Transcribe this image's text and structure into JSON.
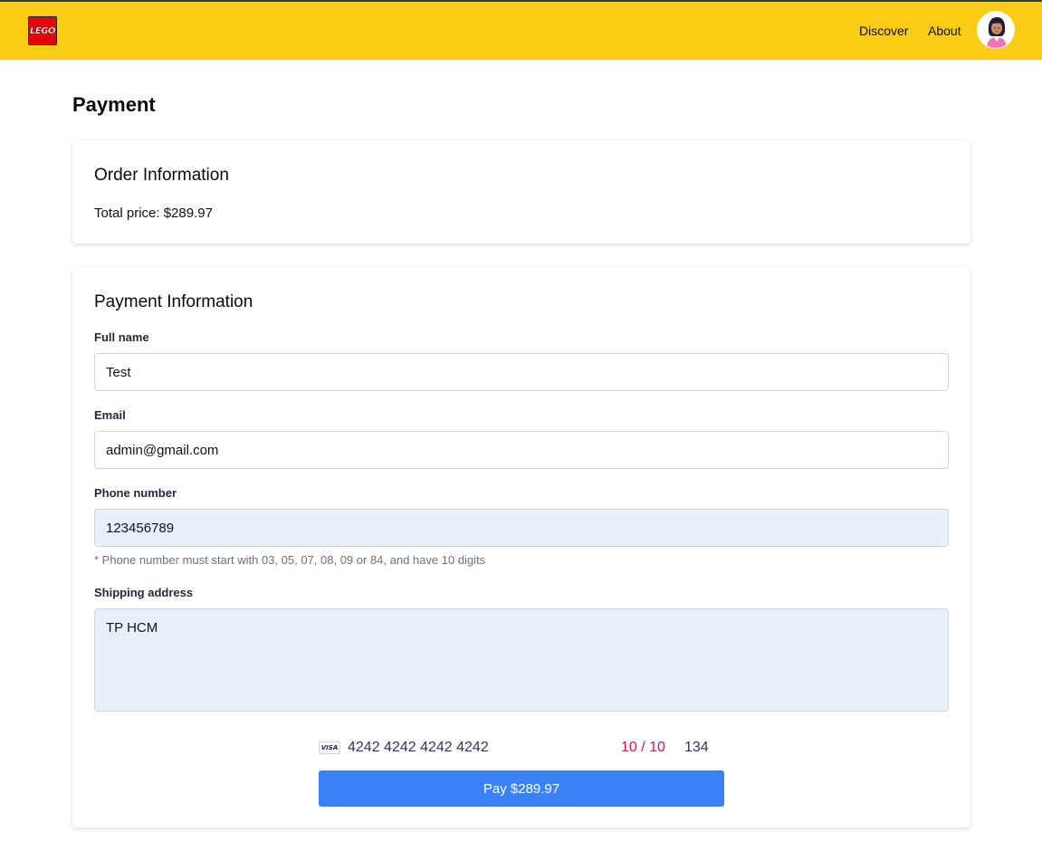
{
  "header": {
    "logo_text": "LEGO",
    "nav": [
      {
        "label": "Discover"
      },
      {
        "label": "About"
      }
    ],
    "colors": {
      "navbar_bg": "#facc15",
      "logo_red": "#e3000b"
    }
  },
  "page": {
    "title": "Payment"
  },
  "order": {
    "title": "Order Information",
    "total_price": "Total price: $289.97"
  },
  "payment": {
    "title": "Payment Information",
    "full_name": {
      "label": "Full name",
      "value": "Test"
    },
    "email": {
      "label": "Email",
      "value": "admin@gmail.com"
    },
    "phone": {
      "label": "Phone number",
      "value": "123456789",
      "hint": "* Phone number must start with 03, 05, 07, 08, 09 or 84, and have 10 digits"
    },
    "address": {
      "label": "Shipping address",
      "value": "TP HCM"
    },
    "card": {
      "brand_icon": "visa-icon",
      "brand_text": "VISA",
      "number": "4242 4242 4242 4242",
      "expiry": "10 / 10",
      "cvc": "134"
    },
    "pay_button": "Pay $289.97",
    "colors": {
      "button": "#3b82f6",
      "expiry_invalid": "#c2185b",
      "autofill_bg": "#e8f0fe"
    }
  }
}
